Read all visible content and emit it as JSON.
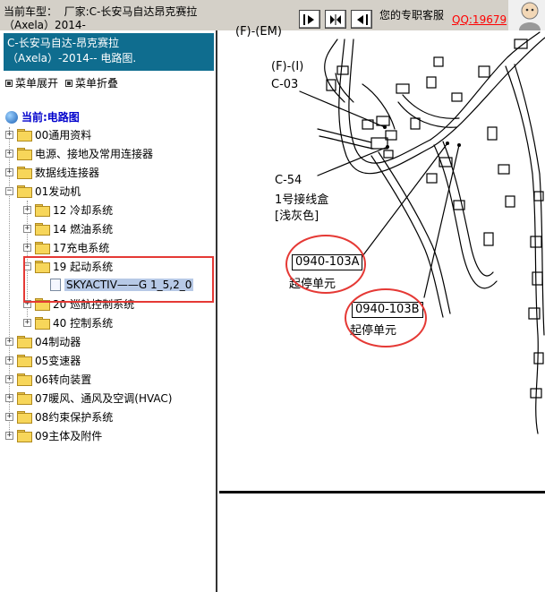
{
  "topbar": {
    "vehicle_text": "当前车型：  厂家:C-长安马自达昂克赛拉\n（Axela）2014-",
    "support_label": "您的专职客服",
    "qq_label": "QQ:19679"
  },
  "sidebar": {
    "title": "C-长安马自达-昂克赛拉\n（Axela）-2014-- 电路图.",
    "expand_label": "菜单展开",
    "collapse_label": "菜单折叠",
    "current_label": "当前:电路图",
    "items": [
      {
        "label": "00通用资料"
      },
      {
        "label": "电源、接地及常用连接器"
      },
      {
        "label": "数据线连接器"
      },
      {
        "label": "01发动机"
      },
      {
        "label": "12 冷却系统"
      },
      {
        "label": "14 燃油系统"
      },
      {
        "label": "17充电系统"
      },
      {
        "label": "19 起动系统"
      },
      {
        "label": "SKYACTIV——G 1_5,2_0"
      },
      {
        "label": "20 巡航控制系统"
      },
      {
        "label": "40 控制系统"
      },
      {
        "label": "04制动器"
      },
      {
        "label": "05变速器"
      },
      {
        "label": "06转向装置"
      },
      {
        "label": "07暖风、通风及空调(HVAC)"
      },
      {
        "label": "08约束保护系统"
      },
      {
        "label": "09主体及附件"
      }
    ]
  },
  "diagram": {
    "top_label": "(F)-(EM)",
    "label_fi": "(F)-(I)",
    "label_c03": "C-03",
    "label_c54": "C-54",
    "label_c54_desc1": "1号接线盒",
    "label_c54_desc2": "[浅灰色]",
    "box_a": "0940-103A",
    "box_a_desc": "起停单元",
    "box_b": "0940-103B",
    "box_b_desc": "起停单元"
  }
}
